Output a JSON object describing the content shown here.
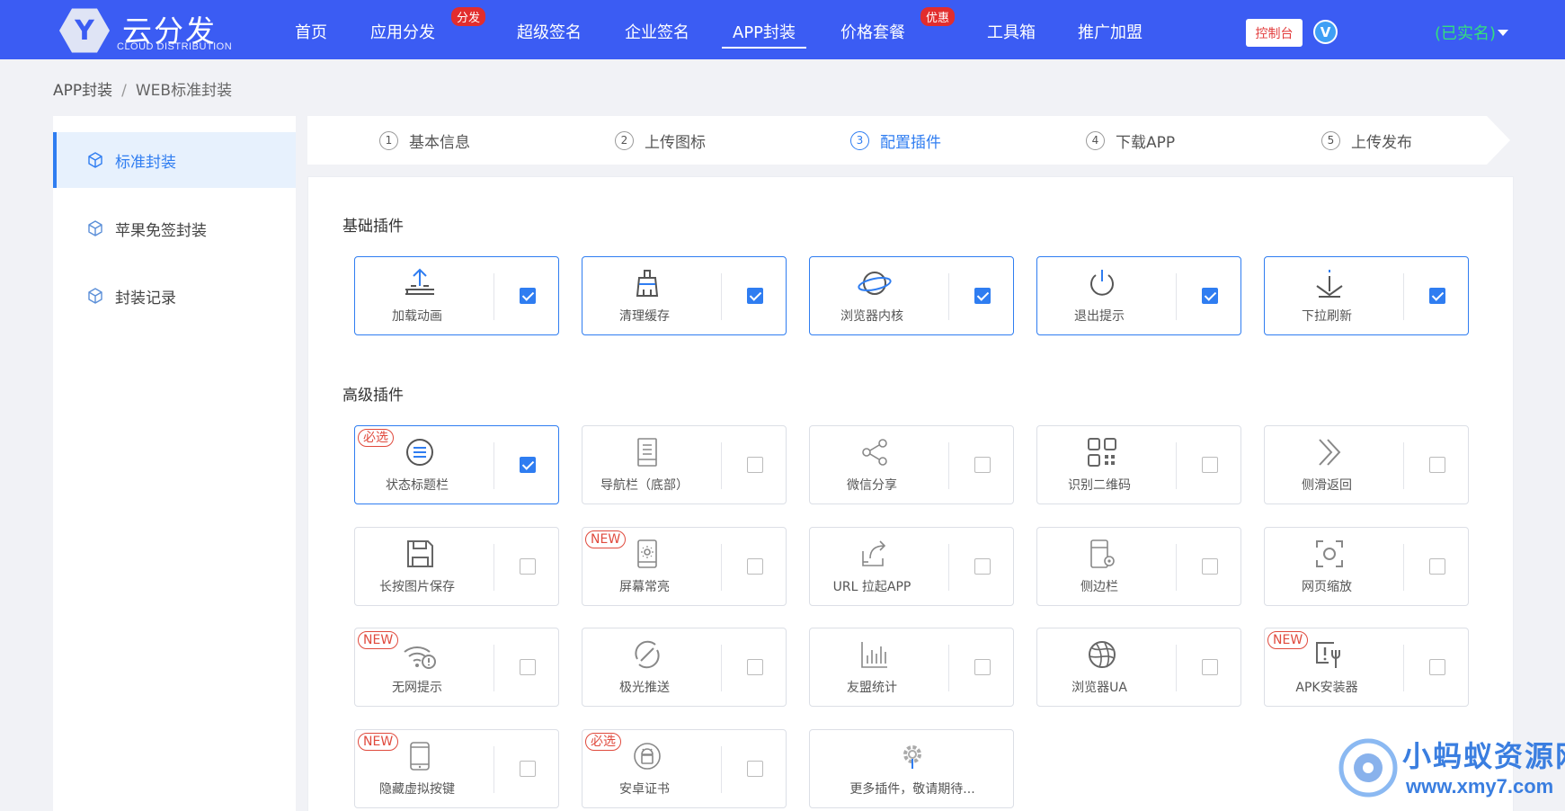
{
  "header": {
    "logo_letter": "Y",
    "logo_name": "云分发",
    "logo_sub": "CLOUD DISTRIBUTION",
    "nav": [
      {
        "label": "首页"
      },
      {
        "label": "应用分发",
        "badge": "分发"
      },
      {
        "label": "超级签名"
      },
      {
        "label": "企业签名"
      },
      {
        "label": "APP封装",
        "active": true
      },
      {
        "label": "价格套餐",
        "badge": "优惠"
      },
      {
        "label": "工具箱"
      },
      {
        "label": "推广加盟"
      }
    ],
    "console_label": "控制台",
    "vip_label": "V",
    "user_label": "(已实名)"
  },
  "breadcrumb": {
    "root": "APP封装",
    "separator": "/",
    "current": "WEB标准封装"
  },
  "sidebar": {
    "items": [
      {
        "label": "标准封装",
        "active": true
      },
      {
        "label": "苹果免签封装"
      },
      {
        "label": "封装记录"
      }
    ]
  },
  "steps": [
    {
      "num": "1",
      "label": "基本信息"
    },
    {
      "num": "2",
      "label": "上传图标"
    },
    {
      "num": "3",
      "label": "配置插件",
      "active": true
    },
    {
      "num": "4",
      "label": "下载APP"
    },
    {
      "num": "5",
      "label": "上传发布"
    }
  ],
  "basic": {
    "title": "基础插件",
    "plugins": [
      {
        "label": "加载动画",
        "icon": "upload-loading-icon",
        "checked": true
      },
      {
        "label": "清理缓存",
        "icon": "broom-icon",
        "checked": true
      },
      {
        "label": "浏览器内核",
        "icon": "planet-icon",
        "checked": true
      },
      {
        "label": "退出提示",
        "icon": "power-icon",
        "checked": true
      },
      {
        "label": "下拉刷新",
        "icon": "pull-down-icon",
        "checked": true
      }
    ]
  },
  "advanced": {
    "title": "高级插件",
    "plugins": [
      {
        "label": "状态标题栏",
        "icon": "status-bar-icon",
        "checked": true,
        "tag": "必选"
      },
      {
        "label": "导航栏（底部）",
        "icon": "nav-bar-icon",
        "checked": false
      },
      {
        "label": "微信分享",
        "icon": "share-icon",
        "checked": false
      },
      {
        "label": "识别二维码",
        "icon": "qrcode-icon",
        "checked": false
      },
      {
        "label": "侧滑返回",
        "icon": "swipe-back-icon",
        "checked": false
      },
      {
        "label": "长按图片保存",
        "icon": "save-icon",
        "checked": false
      },
      {
        "label": "屏幕常亮",
        "icon": "screen-bright-icon",
        "checked": false,
        "tag": "NEW"
      },
      {
        "label": "URL 拉起APP",
        "icon": "url-open-icon",
        "checked": false
      },
      {
        "label": "侧边栏",
        "icon": "sidebar-icon",
        "checked": false
      },
      {
        "label": "网页缩放",
        "icon": "zoom-icon",
        "checked": false
      },
      {
        "label": "无网提示",
        "icon": "no-wifi-icon",
        "checked": false,
        "tag": "NEW"
      },
      {
        "label": "极光推送",
        "icon": "push-icon",
        "checked": false
      },
      {
        "label": "友盟统计",
        "icon": "stats-icon",
        "checked": false
      },
      {
        "label": "浏览器UA",
        "icon": "globe-icon",
        "checked": false
      },
      {
        "label": "APK安装器",
        "icon": "apk-installer-icon",
        "checked": false,
        "tag": "NEW"
      },
      {
        "label": "隐藏虚拟按键",
        "icon": "phone-icon",
        "checked": false,
        "tag": "NEW"
      },
      {
        "label": "安卓证书",
        "icon": "android-icon",
        "checked": false,
        "tag": "必选"
      }
    ],
    "more_label": "更多插件，敬请期待..."
  },
  "watermark": {
    "text": "小蚂蚁资源网",
    "url": "www.xmy7.com"
  },
  "colors": {
    "nav_bg": "#3b5cf3",
    "accent": "#2f7df1",
    "tag_red": "#e04a3d",
    "verified_green": "#34e07c"
  }
}
